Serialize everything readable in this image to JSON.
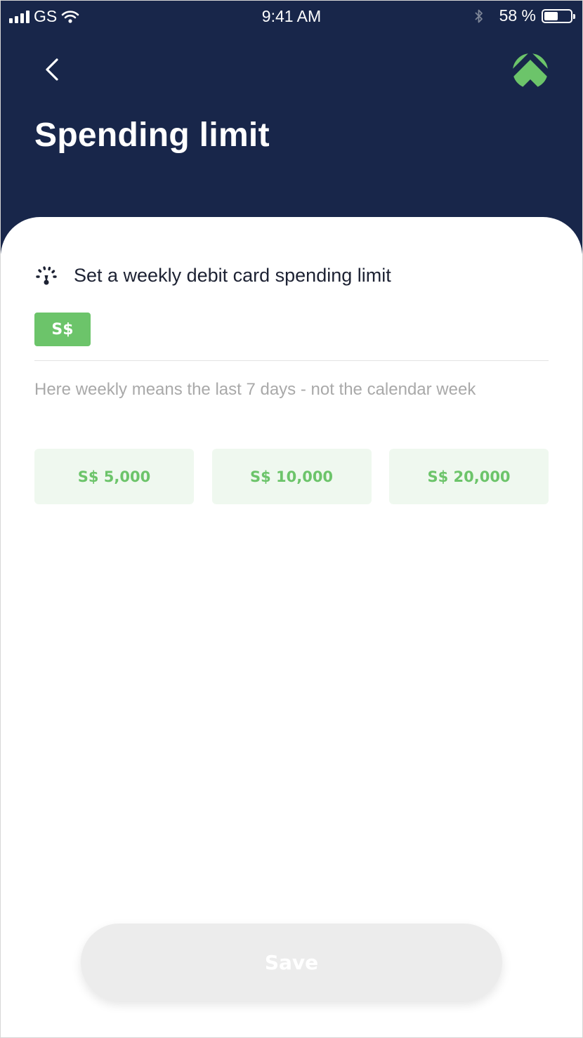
{
  "status_bar": {
    "carrier": "GS",
    "time": "9:41 AM",
    "battery": "58 %",
    "battery_level": 0.58
  },
  "header": {
    "title": "Spending limit",
    "back_icon": "chevron-left-icon",
    "logo_icon": "brand-logo-icon",
    "background_color": "#18264a",
    "logo_color": "#6cc46a"
  },
  "limit": {
    "label": "Set a weekly debit card spending limit",
    "icon": "gauge-icon",
    "currency": "S$",
    "value": "",
    "hint": "Here weekly means the last 7 days - not the calendar week"
  },
  "presets": [
    {
      "label": "S$ 5,000"
    },
    {
      "label": "S$ 10,000"
    },
    {
      "label": "S$ 20,000"
    }
  ],
  "footer": {
    "save_label": "Save"
  },
  "colors": {
    "accent": "#6cc46a",
    "preset_background": "#eff8ef",
    "disabled_button": "#ececec"
  }
}
